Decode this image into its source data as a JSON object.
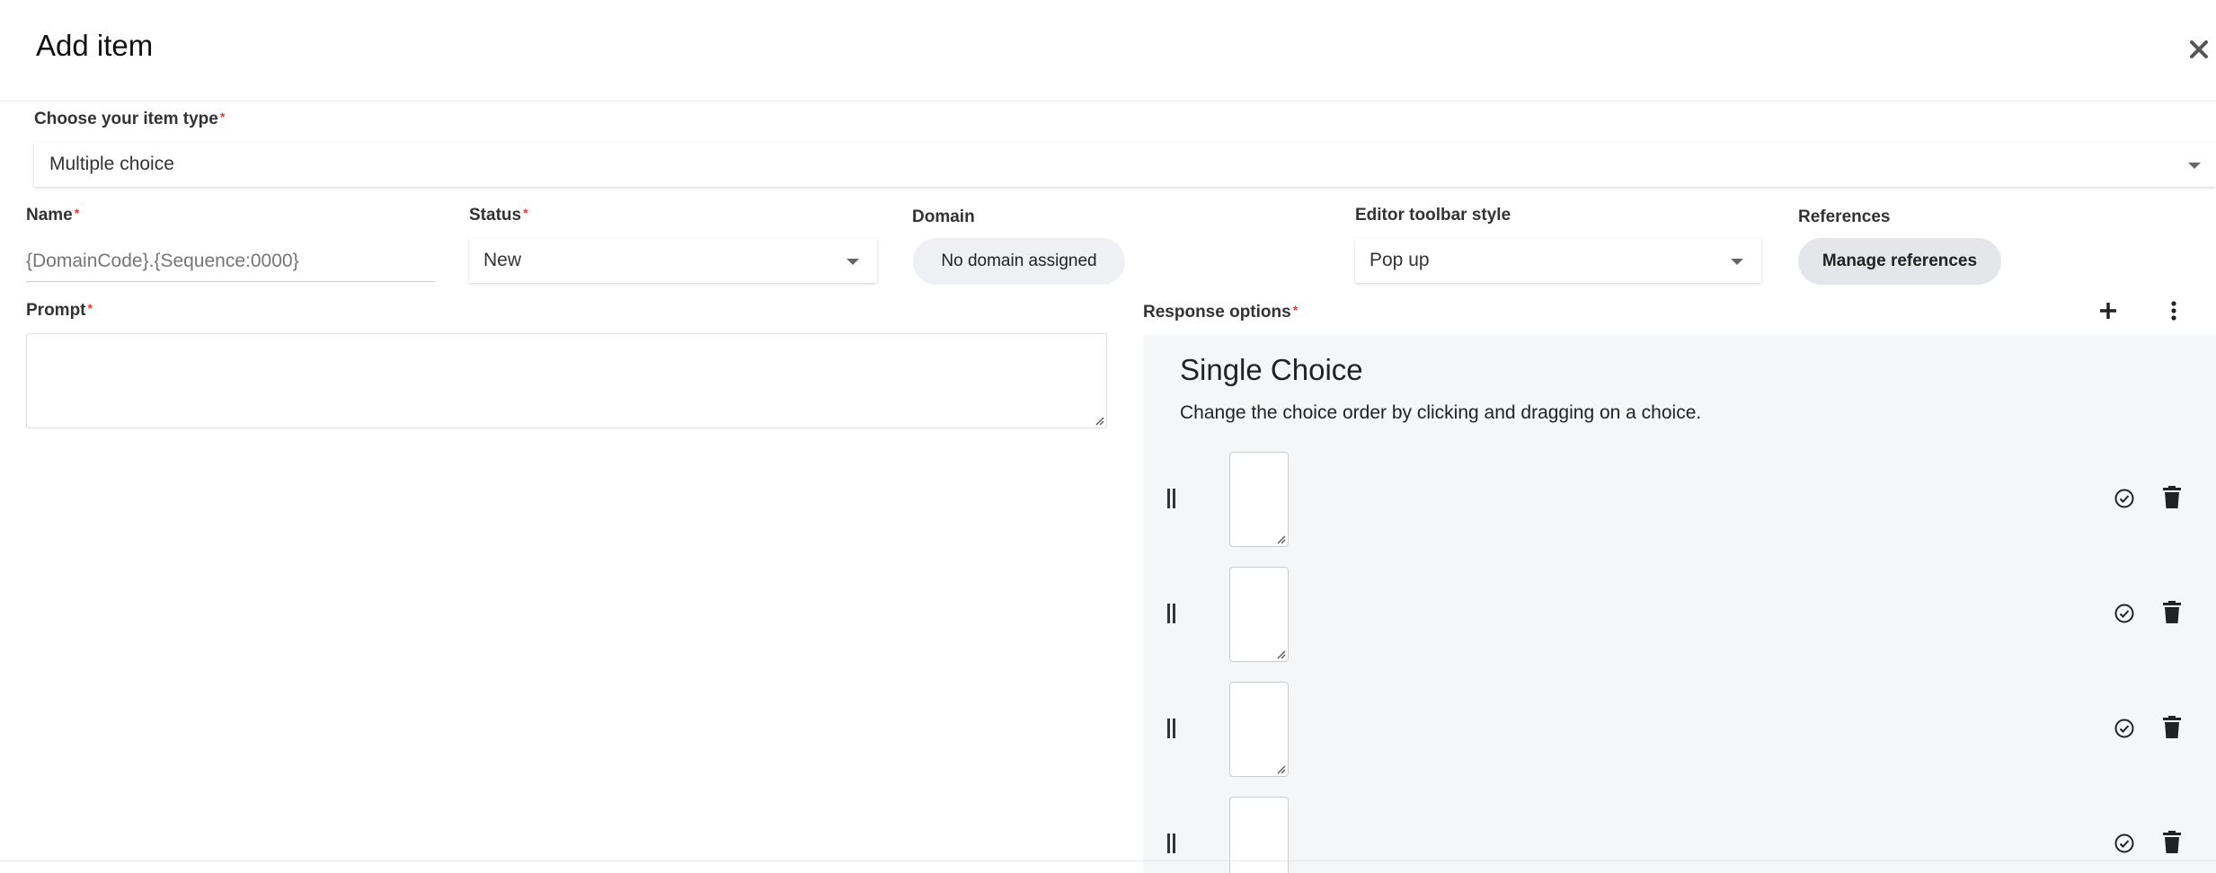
{
  "dialog": {
    "title": "Add item"
  },
  "item_type": {
    "label": "Choose your item type",
    "value": "Multiple choice"
  },
  "fields": {
    "name": {
      "label": "Name",
      "placeholder": "{DomainCode}.{Sequence:0000}"
    },
    "status": {
      "label": "Status",
      "value": "New"
    },
    "domain": {
      "label": "Domain",
      "value": "No domain assigned"
    },
    "toolbar_style": {
      "label": "Editor toolbar style",
      "value": "Pop up"
    },
    "references": {
      "label": "References",
      "button": "Manage references"
    },
    "prompt": {
      "label": "Prompt"
    },
    "response_options": {
      "label": "Response options"
    }
  },
  "required_marker": "*",
  "response_panel": {
    "title": "Single Choice",
    "description": "Change the choice order by clicking and dragging on a choice."
  },
  "choices": [
    {},
    {},
    {},
    {}
  ],
  "icons": {
    "close": "close-icon",
    "add": "plus-icon",
    "more": "more-vertical-icon",
    "drag": "drag-handle-icon",
    "correct": "check-circle-icon",
    "delete": "trash-icon"
  },
  "colors": {
    "required": "#e53935",
    "panel_bg": "#f5f6f8",
    "pill_bg": "#eef0f3"
  }
}
